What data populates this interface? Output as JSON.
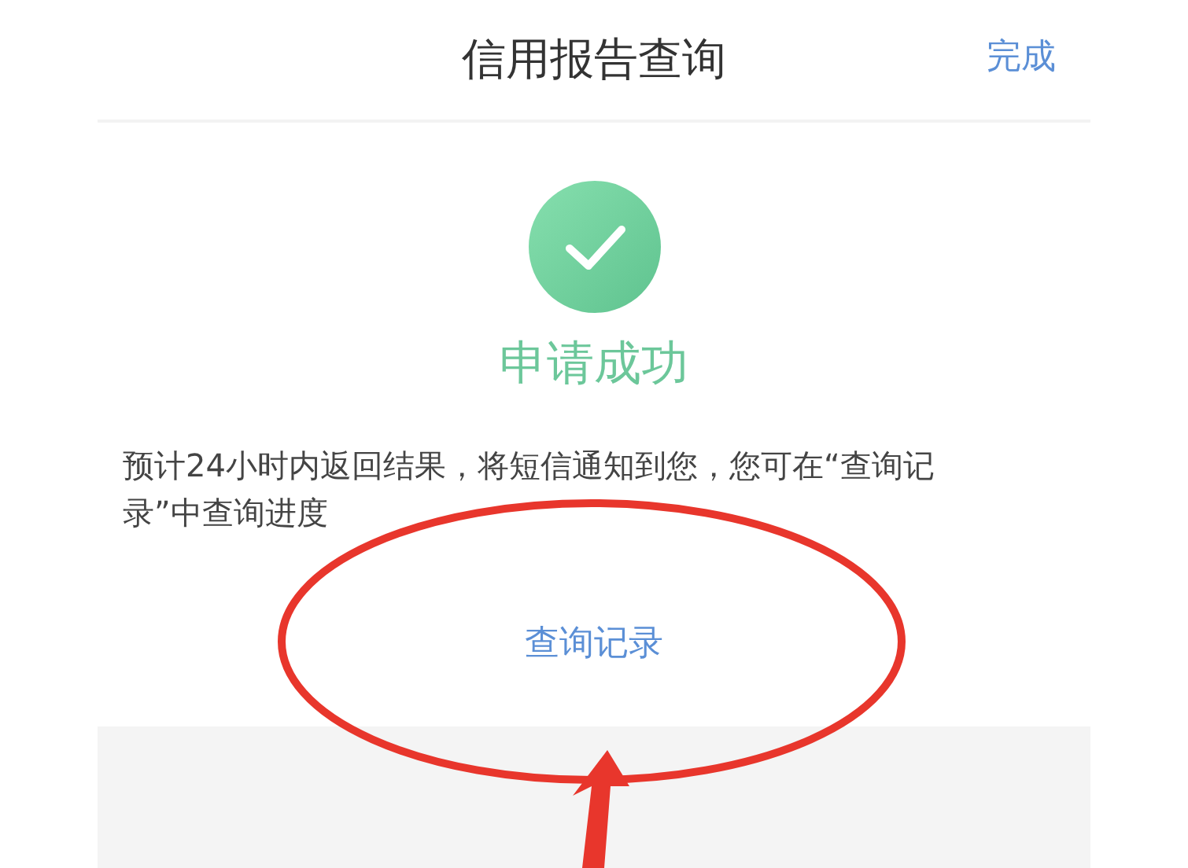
{
  "header": {
    "title": "信用报告查询",
    "action": "完成"
  },
  "result": {
    "success": true,
    "message": "申请成功",
    "description": "预计24小时内返回结果，将短信通知到您，您可在“查询记录”中查询进度",
    "link": "查询记录"
  }
}
